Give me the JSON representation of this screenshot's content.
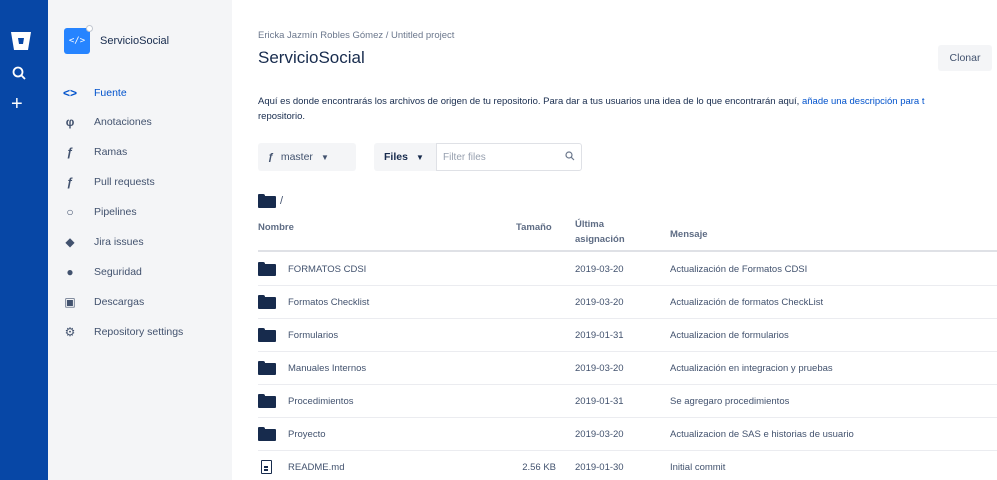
{
  "sidebar": {
    "repo_name": "ServicioSocial",
    "avatar_glyph": "</>",
    "items": [
      {
        "label": "Fuente",
        "icon": "code-icon",
        "glyph": "<>",
        "active": true
      },
      {
        "label": "Anotaciones",
        "icon": "commit-icon",
        "glyph": "φ",
        "active": false
      },
      {
        "label": "Ramas",
        "icon": "branch-icon",
        "glyph": "ƒ",
        "active": false
      },
      {
        "label": "Pull requests",
        "icon": "pull-request-icon",
        "glyph": "ƒ",
        "active": false
      },
      {
        "label": "Pipelines",
        "icon": "pipelines-icon",
        "glyph": "○",
        "active": false
      },
      {
        "label": "Jira issues",
        "icon": "jira-icon",
        "glyph": "◆",
        "active": false
      },
      {
        "label": "Seguridad",
        "icon": "shield-icon",
        "glyph": "●",
        "active": false
      },
      {
        "label": "Descargas",
        "icon": "download-icon",
        "glyph": "▣",
        "active": false
      },
      {
        "label": "Repository settings",
        "icon": "gear-icon",
        "glyph": "⚙",
        "active": false
      }
    ]
  },
  "header": {
    "breadcrumb": "Ericka Jazmín Robles Gómez  /  Untitled project",
    "title": "ServicioSocial",
    "clone_label": "Clonar"
  },
  "description": {
    "text": "Aquí es donde encontrarás los archivos de origen de tu repositorio. Para dar a tus usuarios una idea de lo que encontrarán aquí, ",
    "link": "añade una descripción para t",
    "text2": "repositorio."
  },
  "toolbar": {
    "branch": "master",
    "files_label": "Files",
    "filter_placeholder": "Filter files"
  },
  "path": "/",
  "table": {
    "headers": {
      "name": "Nombre",
      "size": "Tamaño",
      "date": "Última asignación",
      "message": "Mensaje"
    },
    "rows": [
      {
        "type": "folder",
        "name": "FORMATOS CDSI",
        "size": "",
        "date": "2019-03-20",
        "message": "Actualización de Formatos CDSI"
      },
      {
        "type": "folder",
        "name": "Formatos Checklist",
        "size": "",
        "date": "2019-03-20",
        "message": "Actualización de formatos CheckList"
      },
      {
        "type": "folder",
        "name": "Formularios",
        "size": "",
        "date": "2019-01-31",
        "message": "Actualizacion de formularios"
      },
      {
        "type": "folder",
        "name": "Manuales Internos",
        "size": "",
        "date": "2019-03-20",
        "message": "Actualización en integracion y pruebas"
      },
      {
        "type": "folder",
        "name": "Procedimientos",
        "size": "",
        "date": "2019-01-31",
        "message": "Se agregaro procedimientos"
      },
      {
        "type": "folder",
        "name": "Proyecto",
        "size": "",
        "date": "2019-03-20",
        "message": "Actualizacion de SAS e historias de usuario"
      },
      {
        "type": "file",
        "name": "README.md",
        "size": "2.56 KB",
        "date": "2019-01-30",
        "message": "Initial commit"
      }
    ]
  },
  "colors": {
    "global_nav": "#0747a6",
    "accent": "#0052cc",
    "sidebar_bg": "#f4f5f7"
  }
}
